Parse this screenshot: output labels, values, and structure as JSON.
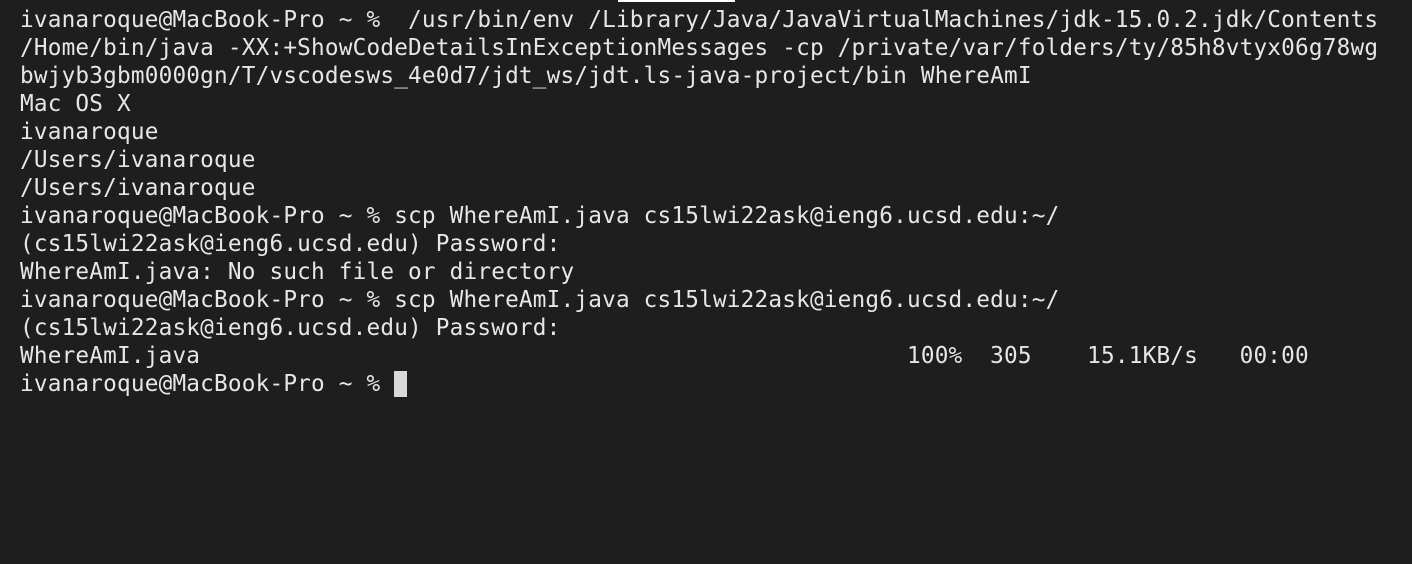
{
  "terminal": {
    "lines": [
      "ivanaroque@MacBook-Pro ~ %  /usr/bin/env /Library/Java/JavaVirtualMachines/jdk-15.0.2.jdk/Contents",
      "/Home/bin/java -XX:+ShowCodeDetailsInExceptionMessages -cp /private/var/folders/ty/85h8vtyx06g78wg",
      "bwjyb3gbm0000gn/T/vscodesws_4e0d7/jdt_ws/jdt.ls-java-project/bin WhereAmI",
      "Mac OS X",
      "ivanaroque",
      "/Users/ivanaroque",
      "/Users/ivanaroque",
      "ivanaroque@MacBook-Pro ~ % scp WhereAmI.java cs15lwi22ask@ieng6.ucsd.edu:~/",
      "(cs15lwi22ask@ieng6.ucsd.edu) Password:",
      "WhereAmI.java: No such file or directory",
      "ivanaroque@MacBook-Pro ~ % scp WhereAmI.java cs15lwi22ask@ieng6.ucsd.edu:~/",
      "(cs15lwi22ask@ieng6.ucsd.edu) Password:",
      "WhereAmI.java                                                   100%  305    15.1KB/s   00:00"
    ],
    "prompt": "ivanaroque@MacBook-Pro ~ % ",
    "colors": {
      "background": "#1e1e1e",
      "foreground": "#e6e6e6",
      "cursor": "#d8d8d8"
    }
  }
}
